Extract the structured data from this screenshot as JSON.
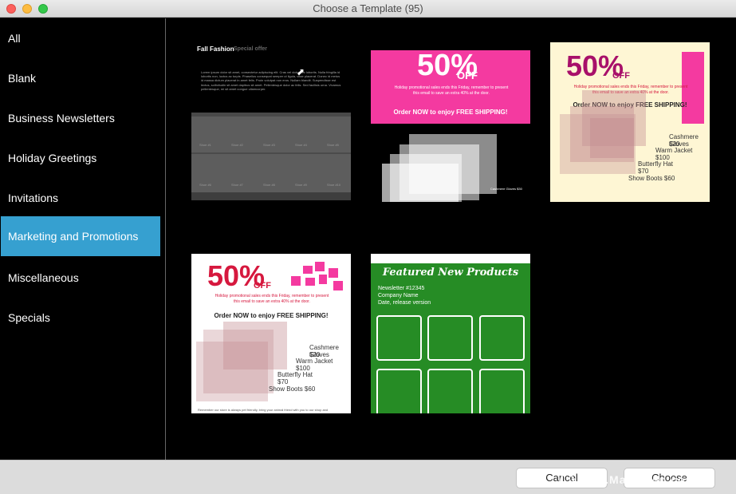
{
  "window": {
    "title": "Choose a Template (95)"
  },
  "sidebar": {
    "items": [
      {
        "label": "All"
      },
      {
        "label": "Blank"
      },
      {
        "label": "Business Newsletters"
      },
      {
        "label": "Holiday Greetings"
      },
      {
        "label": "Invitations"
      },
      {
        "label": "Marketing and Promotions",
        "selected": true
      },
      {
        "label": "Miscellaneous"
      },
      {
        "label": "Specials"
      }
    ]
  },
  "templates": {
    "t1": {
      "title": "Fall Fashion",
      "subtitle": "Special offer",
      "body": "Lorem ipsum dolor sit amet, consectetur adipiscing elit. Cras vel dolor nec lobortis. Nulla fringilla id lobortis non, luctus ac turpis. Phasellus consequat semper ut ligula, vitae placerat. Donec id metus id massa dictum placerat in amet felis. Proin volutpat non eros. Nullam blandit. Suspendisse est lectus, sollicitudin sit amet dapibus sit amet. Pellentesque dolor ac felis. Sed facilisis urna. Vivamus pellentesque, mi sit amet congue ullamcorper.",
      "items": [
        "Shoe #1",
        "Shoe #2",
        "Shoe #3",
        "Shoe #4",
        "Shoe #5",
        "Shoe #6",
        "Shoe #7",
        "Shoe #8",
        "Shoe #9",
        "Shoe #10"
      ]
    },
    "t2": {
      "percent": "50%",
      "off": "OFF",
      "promo": "Holiday promotional sales ends this Friday, remember to present this email to save an extra 40% at the door.",
      "cta": "Order NOW to enjoy FREE SHIPPING!",
      "item": "Cashmere Gloves $30"
    },
    "t3": {
      "percent": "50%",
      "off": "OFF",
      "promo": "Holiday promotional sales ends this Friday, remember to present this email to save an extra 40% at the door.",
      "cta": "Order NOW to enjoy FREE SHIPPING!",
      "prices": [
        "Cashmere Gloves",
        "$20",
        "Warm Jacket",
        "$100",
        "Butterfly Hat",
        "$70",
        "Show Boots $60"
      ]
    },
    "t4": {
      "percent": "50%",
      "off": "OFF",
      "promo": "Holiday promotional sales ends this Friday, remember to present this email to save an extra 40% at the door.",
      "cta": "Order NOW to enjoy FREE SHIPPING!",
      "prices": [
        "Cashmere Gloves",
        "$20",
        "Warm Jacket",
        "$100",
        "Butterfly Hat",
        "$70",
        "Show Boots $60"
      ],
      "footer": "Remember our store is always pet friendly, bring your animal friend with you to our shop and"
    },
    "t5": {
      "title": "Featured New Products",
      "line1": "Newsletter #12345",
      "line2": "Company Name",
      "line3": "Date, release version"
    }
  },
  "footer": {
    "cancel_label": "Cancel",
    "choose_label": "Choose",
    "watermark": "www.MacDown.com"
  },
  "colors": {
    "accent": "#36a0d0",
    "pink": "#f43aa0",
    "green": "#268c25",
    "cream": "#fef6d4",
    "magenta": "#a8106a",
    "red": "#d6183e"
  }
}
